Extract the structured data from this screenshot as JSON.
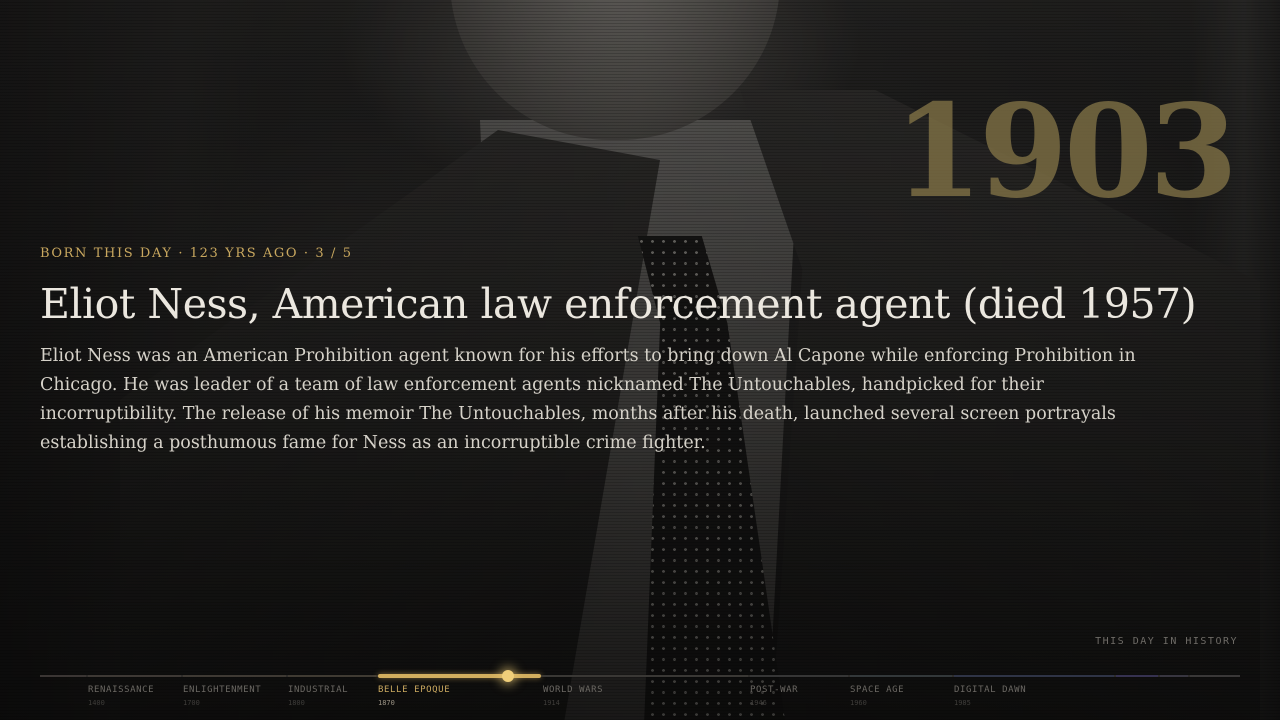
{
  "hero": {
    "year": "1903",
    "eyebrow": "BORN THIS DAY · 123 YRS AGO · 3 / 5",
    "title": "Eliot Ness, American law enforcement agent (died 1957)",
    "description": "Eliot Ness was an American Prohibition agent known for his efforts to bring down Al Capone while enforcing Prohibition in Chicago. He was leader of a team of law enforcement agents nicknamed The Untouchables, handpicked for their incorruptibility. The release of his memoir The Untouchables, months after his death, launched several screen portrayals establishing a posthumous fame for Ness as an incorruptible crime fighter."
  },
  "footer": {
    "label": "THIS DAY IN HISTORY"
  },
  "timeline": {
    "accent": "#d2ae5e",
    "position_year": 1903,
    "eras": [
      {
        "name": "RENAISSANCE",
        "year": "1400"
      },
      {
        "name": "ENLIGHTENMENT",
        "year": "1700"
      },
      {
        "name": "INDUSTRIAL",
        "year": "1800"
      },
      {
        "name": "BELLE EPOQUE",
        "year": "1870",
        "active": true
      },
      {
        "name": "WORLD WARS",
        "year": "1914"
      },
      {
        "name": "POST-WAR",
        "year": "1946"
      },
      {
        "name": "SPACE AGE",
        "year": "1960"
      },
      {
        "name": "DIGITAL DAWN",
        "year": "1985"
      }
    ]
  }
}
